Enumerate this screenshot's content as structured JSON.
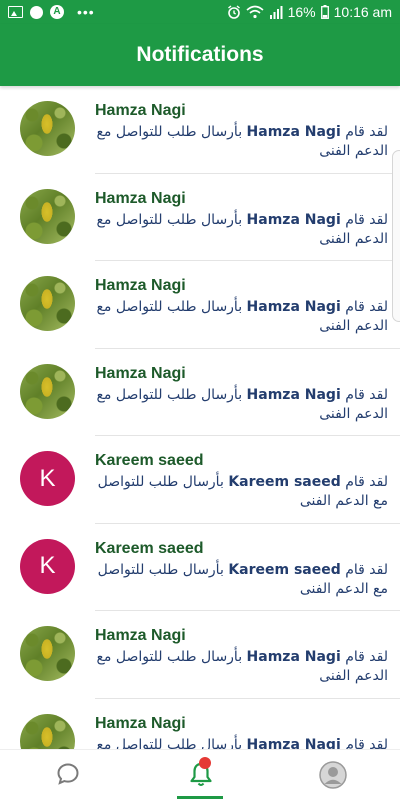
{
  "status_bar": {
    "battery": "16%",
    "time": "10:16 am",
    "icons": [
      "image-icon",
      "notification-icon",
      "a-icon",
      "more-icon",
      "alarm-icon",
      "wifi-icon",
      "signal-icon",
      "battery-icon"
    ]
  },
  "app_bar": {
    "title": "Notifications"
  },
  "notifications": [
    {
      "name": "Hamza Nagi",
      "avatar_type": "photo",
      "msg_prefix": "لقد قام",
      "msg_name": "Hamza Nagi",
      "msg_suffix": "بأرسال طلب للتواصل مع الدعم الفنى"
    },
    {
      "name": "Hamza Nagi",
      "avatar_type": "photo",
      "msg_prefix": "لقد قام",
      "msg_name": "Hamza Nagi",
      "msg_suffix": "بأرسال طلب للتواصل مع الدعم الفنى"
    },
    {
      "name": "Hamza Nagi",
      "avatar_type": "photo",
      "msg_prefix": "لقد قام",
      "msg_name": "Hamza Nagi",
      "msg_suffix": "بأرسال طلب للتواصل مع الدعم الفنى"
    },
    {
      "name": "Hamza Nagi",
      "avatar_type": "photo",
      "msg_prefix": "لقد قام",
      "msg_name": "Hamza Nagi",
      "msg_suffix": "بأرسال طلب للتواصل مع الدعم الفنى"
    },
    {
      "name": "Kareem saeed",
      "avatar_type": "letter",
      "avatar_letter": "K",
      "msg_prefix": "لقد قام",
      "msg_name": "Kareem saeed",
      "msg_suffix": "بأرسال طلب للتواصل مع الدعم الفنى"
    },
    {
      "name": "Kareem saeed",
      "avatar_type": "letter",
      "avatar_letter": "K",
      "msg_prefix": "لقد قام",
      "msg_name": "Kareem saeed",
      "msg_suffix": "بأرسال طلب للتواصل مع الدعم الفنى"
    },
    {
      "name": "Hamza Nagi",
      "avatar_type": "photo",
      "msg_prefix": "لقد قام",
      "msg_name": "Hamza Nagi",
      "msg_suffix": "بأرسال طلب للتواصل مع الدعم الفنى"
    },
    {
      "name": "Hamza Nagi",
      "avatar_type": "photo",
      "msg_prefix": "لقد قام",
      "msg_name": "Hamza Nagi",
      "msg_suffix": "بأرسال طلب للتواصل مع الدعم الفنى"
    }
  ],
  "bottom_nav": {
    "items": [
      {
        "icon": "chat-bubble-icon",
        "active": false
      },
      {
        "icon": "bell-icon",
        "active": true,
        "has_badge": true
      },
      {
        "icon": "profile-icon",
        "active": false
      }
    ]
  },
  "colors": {
    "primary": "#1e9a45",
    "name_text": "#1d5a2a",
    "message_text": "#233d6e",
    "letter_avatar": "#c2185b",
    "badge": "#e53935"
  }
}
